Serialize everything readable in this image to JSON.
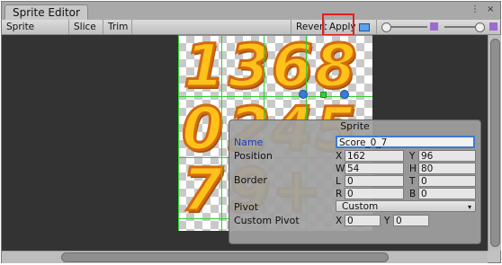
{
  "window": {
    "tab_title": "Sprite Editor",
    "controls": [
      "⋮",
      "×"
    ]
  },
  "toolbar": {
    "sprite_editor_menu": "Sprite Editor ▾",
    "slice_menu": "Slice ▾",
    "trim_label": "Trim",
    "revert_label": "Revert",
    "apply_label": "Apply"
  },
  "sprite_sheet": {
    "digits": [
      "1",
      "3",
      "6",
      "8",
      "0",
      "2",
      "4",
      "5",
      "7",
      "9",
      "+"
    ]
  },
  "sprite_panel": {
    "title": "Sprite",
    "name_label": "Name",
    "name_value": "Score_0_7",
    "position_label": "Position",
    "x_axis": "X",
    "x_value": "162",
    "y_axis": "Y",
    "y_value": "96",
    "w_axis": "W",
    "w_value": "54",
    "h_axis": "H",
    "h_value": "80",
    "border_label": "Border",
    "l_axis": "L",
    "l_value": "0",
    "t_axis": "T",
    "t_value": "0",
    "r_axis": "R",
    "r_value": "0",
    "b_axis": "B",
    "b_value": "0",
    "pivot_label": "Pivot",
    "pivot_value": "Custom",
    "custom_pivot_label": "Custom Pivot",
    "cp_x_axis": "X",
    "cp_x_value": "0",
    "cp_y_axis": "Y",
    "cp_y_value": "0"
  },
  "colors": {
    "highlight_box": "#e02020",
    "slice_grid": "#2fd12f",
    "canvas_bg": "#333333"
  }
}
